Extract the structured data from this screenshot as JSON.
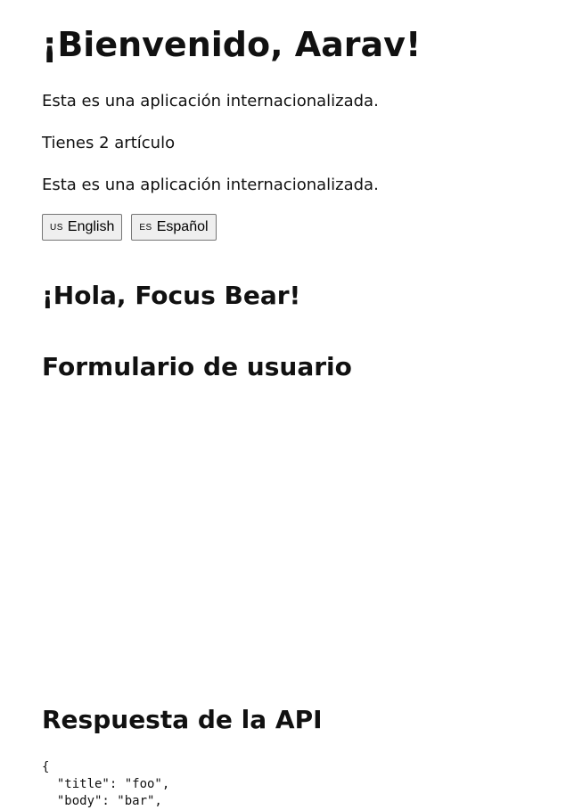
{
  "greeting": {
    "title": "¡Bienvenido, Aarav!"
  },
  "paragraphs": {
    "intro": "Esta es una aplicación internacionalizada.",
    "items": "Tienes 2 artículo",
    "intro_repeat": "Esta es una aplicación internacionalizada."
  },
  "language_buttons": [
    {
      "flag": "US",
      "label": "English"
    },
    {
      "flag": "ES",
      "label": "Español"
    }
  ],
  "sections": {
    "hello": "¡Hola, Focus Bear!",
    "user_form": "Formulario de usuario",
    "api_response": "Respuesta de la API"
  },
  "api_response": {
    "lines": [
      "{",
      "  \"title\": \"foo\",",
      "  \"body\": \"bar\","
    ]
  }
}
